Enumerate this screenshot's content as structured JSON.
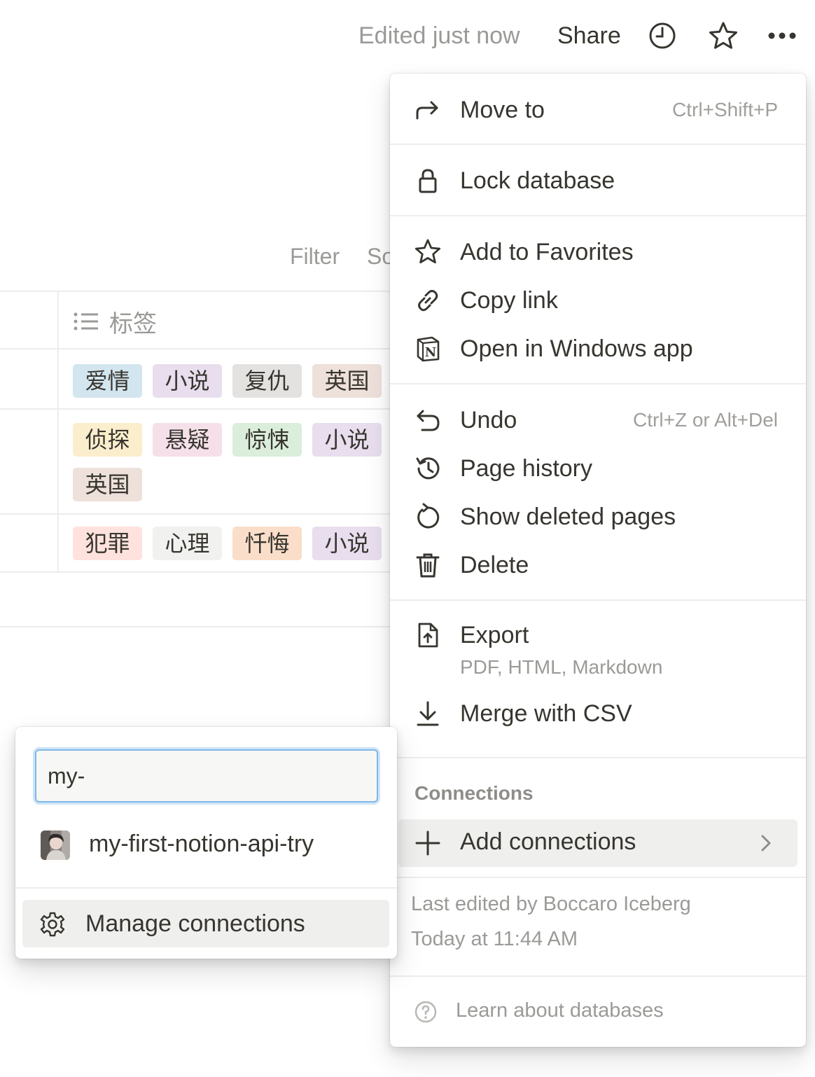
{
  "topbar": {
    "edited": "Edited just now",
    "share": "Share",
    "icons": [
      "clock-icon",
      "star-icon",
      "more-icon"
    ]
  },
  "database": {
    "filter": "Filter",
    "sort": "So",
    "column_header": "标签",
    "rows": [
      {
        "tags": [
          {
            "text": "爱情",
            "color": "#d3e5ef"
          },
          {
            "text": "小说",
            "color": "#e8deee"
          },
          {
            "text": "复仇",
            "color": "#e3e2e0"
          },
          {
            "text": "英国",
            "color": "#eee0da"
          }
        ]
      },
      {
        "tags": [
          {
            "text": "侦探",
            "color": "#fbeecc"
          },
          {
            "text": "悬疑",
            "color": "#f5e0e9"
          },
          {
            "text": "惊悚",
            "color": "#dbeddb"
          },
          {
            "text": "小说",
            "color": "#e8deee"
          },
          {
            "text": "英国",
            "color": "#eee0da"
          }
        ]
      },
      {
        "tags": [
          {
            "text": "犯罪",
            "color": "#ffe2dd"
          },
          {
            "text": "心理",
            "color": "#f1f1ef"
          },
          {
            "text": "忏悔",
            "color": "#fadec9"
          },
          {
            "text": "小说",
            "color": "#e8deee"
          }
        ]
      }
    ]
  },
  "menu": {
    "move_to": {
      "label": "Move to",
      "shortcut": "Ctrl+Shift+P"
    },
    "lock": {
      "label": "Lock database"
    },
    "favorites": {
      "label": "Add to Favorites"
    },
    "copy_link": {
      "label": "Copy link"
    },
    "open_windows": {
      "label": "Open in Windows app"
    },
    "undo": {
      "label": "Undo",
      "shortcut": "Ctrl+Z or Alt+Del"
    },
    "page_history": {
      "label": "Page history"
    },
    "show_deleted": {
      "label": "Show deleted pages"
    },
    "delete": {
      "label": "Delete"
    },
    "export": {
      "label": "Export",
      "sub": "PDF, HTML, Markdown"
    },
    "merge_csv": {
      "label": "Merge with CSV"
    },
    "connections_header": "Connections",
    "add_connections": {
      "label": "Add connections"
    },
    "last_edited_by": "Last edited by Boccaro Iceberg",
    "last_edited_time": "Today at 11:44 AM",
    "learn": {
      "label": "Learn about databases"
    }
  },
  "connections_popup": {
    "search_value": "my-",
    "result": "my-first-notion-api-try",
    "manage": "Manage connections"
  },
  "colors": {
    "accent_focus": "#7fb7e8",
    "hover_bg": "#efefee",
    "text": "#37352f",
    "muted": "#9b9a97"
  }
}
